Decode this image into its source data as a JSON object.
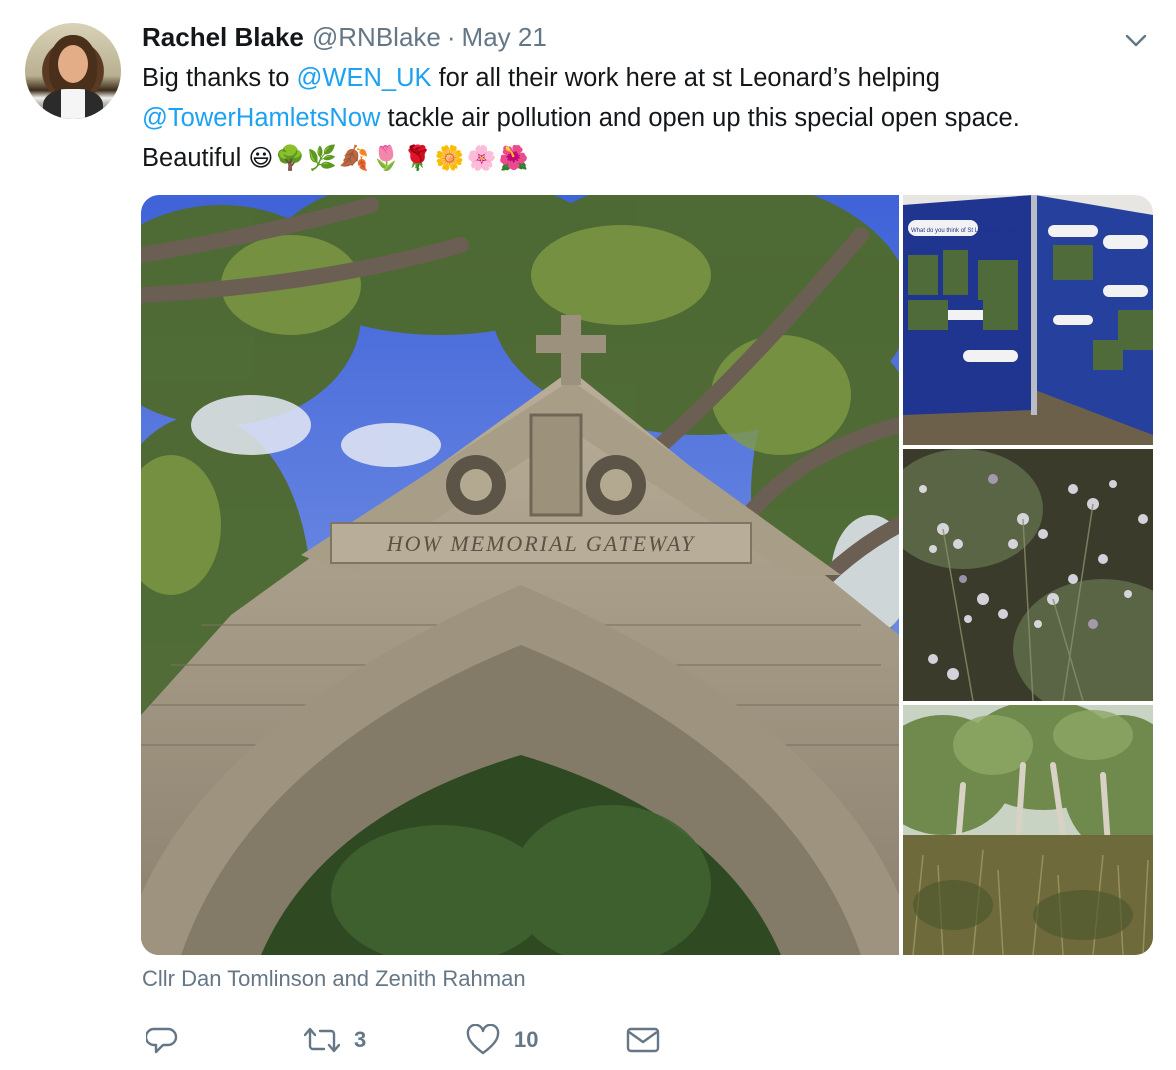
{
  "tweet": {
    "author_name": "Rachel Blake",
    "handle": "@RNBlake",
    "separator": "·",
    "date": "May 21",
    "text": {
      "line1_a": "Big thanks to ",
      "line1_mention": "@WEN_UK",
      "line1_b": " for all their work here at st Leonard’s helping",
      "line2_mention": "@TowerHamletsNow",
      "line2_b": " tackle air pollution and open up this special open space.",
      "line3_a": "Beautiful ",
      "emojis": "😃🌳🌿🍂🌷🌹🌼🌸🌺"
    },
    "media": {
      "gateway_inscription": "HOW MEMORIAL GATEWAY",
      "board_heading": "What do you think of St Leonards Priory"
    },
    "caption": "Cllr Dan Tomlinson and Zenith Rahman",
    "actions": {
      "reply_count": "",
      "retweet_count": "3",
      "like_count": "10"
    }
  },
  "icons": {
    "more": "chevron-down-icon",
    "reply": "reply-icon",
    "retweet": "retweet-icon",
    "like": "heart-icon",
    "dm": "envelope-icon"
  },
  "colors": {
    "link": "#1da1f2",
    "secondary": "#657786",
    "text": "#14171a"
  }
}
